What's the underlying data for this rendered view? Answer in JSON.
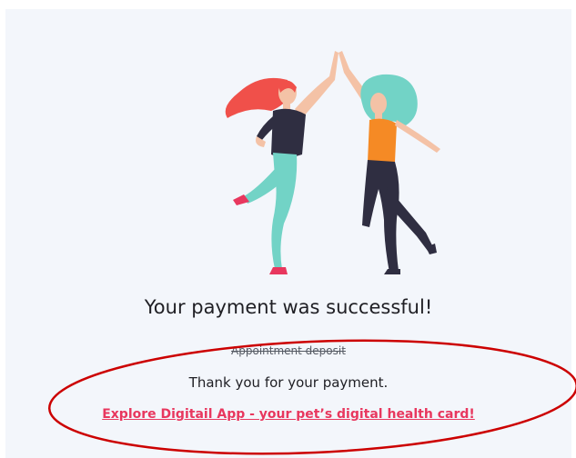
{
  "confirmation": {
    "title": "Your payment was successful!",
    "struck_line": "Appointment deposit",
    "thank_you": "Thank you for your payment.",
    "explore_link": "Explore Digitail App - your pet’s digital health card!"
  },
  "illustration": {
    "icon": "high-five-illustration",
    "colors": {
      "hair_left": "#f0504a",
      "shirt_left": "#2f2e41",
      "pants_left": "#72d3c6",
      "hair_right": "#72d3c6",
      "shirt_right": "#f58a25",
      "pants_right": "#2f2e41",
      "skin": "#f4c2a6",
      "shoe": "#e8375e"
    }
  },
  "annotation": {
    "icon": "red-ellipse-highlight",
    "color": "#cc0000"
  },
  "colors": {
    "background": "#f3f6fb",
    "text": "#1f1f24",
    "link": "#e8375e"
  }
}
